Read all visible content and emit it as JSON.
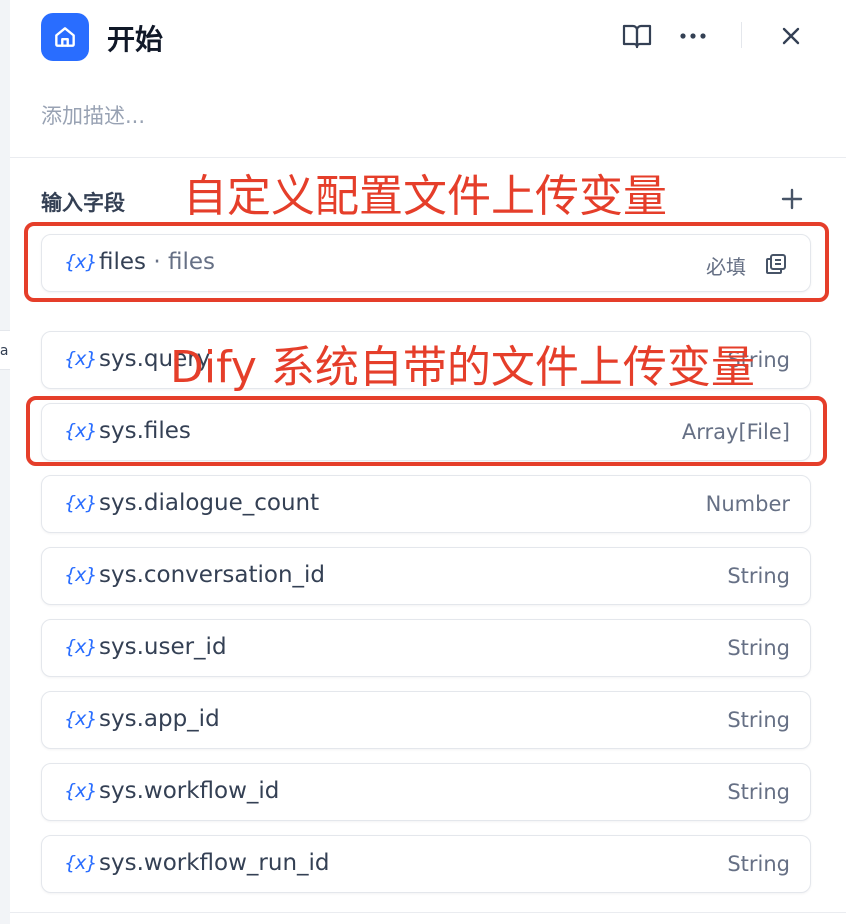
{
  "node": {
    "title": "开始",
    "description_placeholder": "添加描述..."
  },
  "colors": {
    "accent": "#296dff",
    "annotation": "#e53e2a"
  },
  "icons": {
    "node": "home-icon",
    "docs": "book-icon",
    "more": "more-icon",
    "close": "close-icon",
    "add": "plus-icon",
    "variable": "variable-icon",
    "copy": "copy-icon"
  },
  "input_fields": {
    "title": "输入字段",
    "variable_icon_text": "{x}",
    "custom": {
      "name": "files",
      "separator": " · ",
      "label": "files",
      "required": "必填"
    },
    "system": [
      {
        "name": "sys.query",
        "type": "String"
      },
      {
        "name": "sys.files",
        "type": "Array[File]"
      },
      {
        "name": "sys.dialogue_count",
        "type": "Number"
      },
      {
        "name": "sys.conversation_id",
        "type": "String"
      },
      {
        "name": "sys.user_id",
        "type": "String"
      },
      {
        "name": "sys.app_id",
        "type": "String"
      },
      {
        "name": "sys.workflow_id",
        "type": "String"
      },
      {
        "name": "sys.workflow_run_id",
        "type": "String"
      }
    ]
  },
  "annotations": {
    "custom_label": "自定义配置文件上传变量",
    "system_label": "Dify 系统自带的文件上传变量"
  },
  "left_fragment": "la"
}
